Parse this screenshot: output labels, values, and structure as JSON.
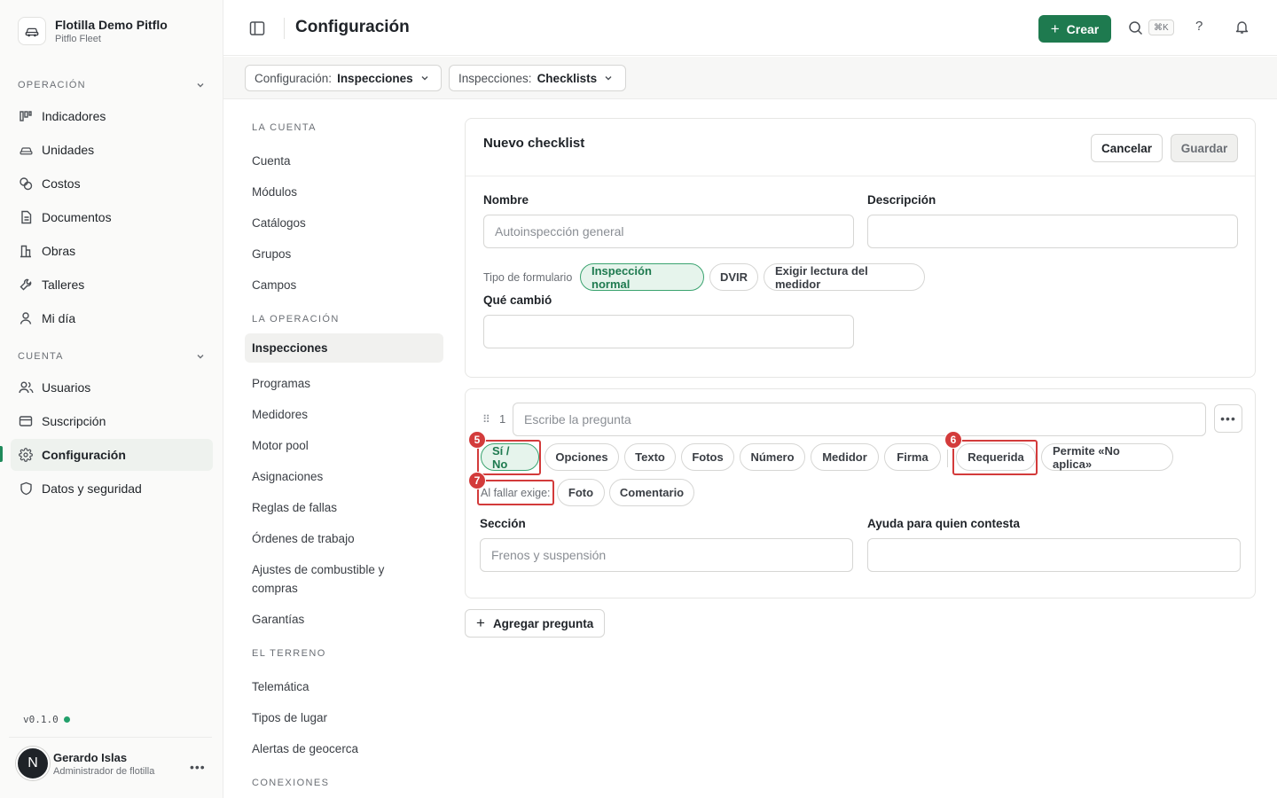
{
  "org": {
    "name": "Flotilla Demo Pitflo",
    "sub": "Pitflo Fleet"
  },
  "sidebar": {
    "sections": [
      {
        "label": "OPERACIÓN"
      },
      {
        "label": "CUENTA"
      }
    ],
    "items": [
      {
        "label": "Indicadores",
        "icon": "bar-chart-icon"
      },
      {
        "label": "Unidades",
        "icon": "car-icon"
      },
      {
        "label": "Costos",
        "icon": "coins-icon"
      },
      {
        "label": "Documentos",
        "icon": "document-icon"
      },
      {
        "label": "Obras",
        "icon": "building-icon"
      },
      {
        "label": "Talleres",
        "icon": "wrench-icon"
      },
      {
        "label": "Mi día",
        "icon": "user-icon"
      },
      {
        "label": "Usuarios",
        "icon": "users-icon"
      },
      {
        "label": "Suscripción",
        "icon": "credit-card-icon"
      },
      {
        "label": "Configuración",
        "icon": "gear-icon",
        "active": true
      },
      {
        "label": "Datos y seguridad",
        "icon": "shield-icon"
      }
    ],
    "version": "v0.1.0",
    "version_status_color": "#22a06b"
  },
  "user": {
    "initial": "N",
    "name": "Gerardo Islas",
    "role": "Administrador de flotilla"
  },
  "topbar": {
    "title": "Configuración",
    "create_label": "Crear",
    "shortcut": "⌘K",
    "help": "?"
  },
  "filters": [
    {
      "key": "Configuración:",
      "value": "Inspecciones"
    },
    {
      "key": "Inspecciones:",
      "value": "Checklists"
    }
  ],
  "settings_nav": {
    "sections": [
      "LA CUENTA",
      "LA OPERACIÓN",
      "EL TERRENO",
      "CONEXIONES"
    ],
    "cuenta": [
      "Cuenta",
      "Módulos",
      "Catálogos",
      "Grupos",
      "Campos"
    ],
    "operacion": [
      "Inspecciones",
      "Programas",
      "Medidores",
      "Motor pool",
      "Asignaciones",
      "Reglas de fallas",
      "Órdenes de trabajo",
      "Ajustes de combustible y compras",
      "Garantías"
    ],
    "terreno": [
      "Telemática",
      "Tipos de lugar",
      "Alertas de geocerca"
    ],
    "active": "Inspecciones"
  },
  "checklist": {
    "title": "Nuevo checklist",
    "cancel": "Cancelar",
    "save": "Guardar",
    "name_label": "Nombre",
    "name_placeholder": "Autoinspección general",
    "desc_label": "Descripción",
    "form_type_label": "Tipo de formulario",
    "form_types": [
      "Inspección normal",
      "DVIR",
      "Exigir lectura del medidor"
    ],
    "form_type_selected": "Inspección normal",
    "changed_label": "Qué cambió"
  },
  "question": {
    "number": "1",
    "placeholder": "Escribe la pregunta",
    "types": [
      "Sí / No",
      "Opciones",
      "Texto",
      "Fotos",
      "Número",
      "Medidor",
      "Firma"
    ],
    "selected_type": "Sí / No",
    "flags": [
      "Requerida",
      "Permite «No aplica»"
    ],
    "fail_label": "Al fallar exige:",
    "fail_options": [
      "Foto",
      "Comentario"
    ],
    "section_label": "Sección",
    "section_placeholder": "Frenos y suspensión",
    "help_label": "Ayuda para quien contesta"
  },
  "markers": [
    "5",
    "6",
    "7"
  ],
  "add_question": "Agregar pregunta",
  "colors": {
    "brand": "#1e7a4f",
    "marker": "#d33b3b"
  }
}
